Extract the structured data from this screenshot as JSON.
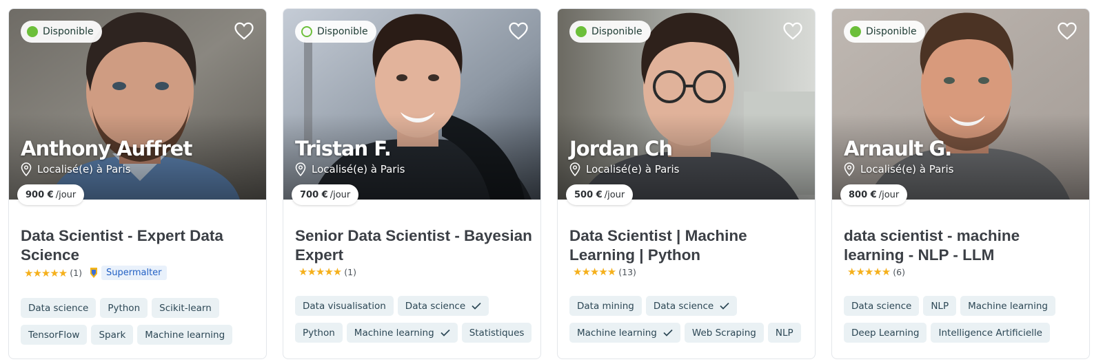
{
  "cards": [
    {
      "availability": "Disponible",
      "name": "Anthony Auffret",
      "location": "Localisé(e) à Paris",
      "price": "900 €",
      "price_unit": "/jour",
      "title": "Data Scientist - Expert Data Science",
      "stars": "★★★★★",
      "rating_count": "(1)",
      "supermalter_label": "Supermalter",
      "skills_row1": [
        "Data science",
        "Python",
        "Scikit-learn"
      ],
      "skills_row2": [
        "TensorFlow",
        "Spark",
        "Machine learning"
      ]
    },
    {
      "availability": "Disponible",
      "name": "Tristan F.",
      "location": "Localisé(e) à Paris",
      "price": "700 €",
      "price_unit": "/jour",
      "title": "Senior Data Scientist - Bayesian Expert",
      "stars": "★★★★★",
      "rating_count": "(1)",
      "skills_row1": [
        "Data visualisation",
        "Data science"
      ],
      "skills_row2": [
        "Python",
        "Machine learning",
        "Statistiques"
      ]
    },
    {
      "availability": "Disponible",
      "name": "Jordan Ch",
      "location": "Localisé(e) à Paris",
      "price": "500 €",
      "price_unit": "/jour",
      "title": "Data Scientist | Machine Learning | Python",
      "stars": "★★★★★",
      "rating_count": "(13)",
      "skills_row1": [
        "Data mining",
        "Data science"
      ],
      "skills_row2": [
        "Machine learning",
        "Web Scraping",
        "NLP"
      ]
    },
    {
      "availability": "Disponible",
      "name": "Arnault G.",
      "location": "Localisé(e) à Paris",
      "price": "800 €",
      "price_unit": "/jour",
      "title": "data scientist - machine learning - NLP - LLM",
      "stars": "★★★★★",
      "rating_count": "(6)",
      "skills_row1": [
        "Data science",
        "NLP",
        "Machine learning"
      ],
      "skills_row2": [
        "Deep Learning",
        "Intelligence Artificielle"
      ]
    }
  ],
  "colors": {
    "available_green": "#6cbf3a",
    "star_yellow": "#f5b01c",
    "supermalter_blue": "#2361c4",
    "tag_background": "#eaf1f4"
  },
  "icons": [
    "heart-icon",
    "location-pin-icon",
    "checkmark-icon",
    "supermalter-badge-icon"
  ]
}
